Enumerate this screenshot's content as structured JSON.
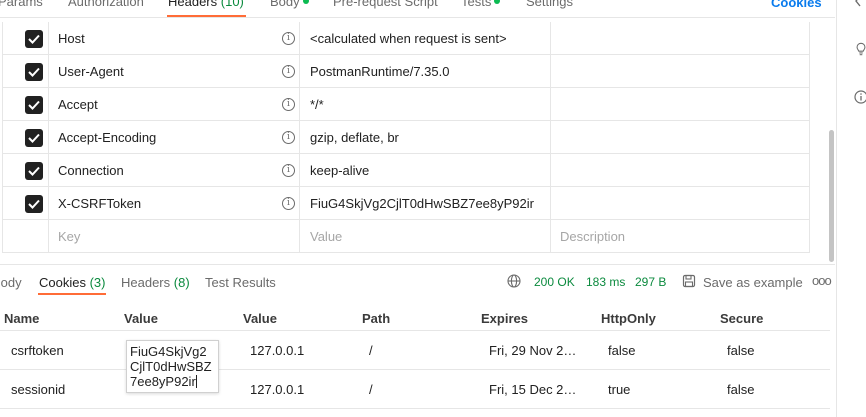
{
  "request_tabs": {
    "params": "Params",
    "authorization": "Authorization",
    "headers": "Headers",
    "headers_count": "(10)",
    "body": "Body",
    "prerequest": "Pre-request Script",
    "tests": "Tests",
    "settings": "Settings",
    "cookies_link": "Cookies"
  },
  "headers_table": {
    "rows": [
      {
        "key": "Host",
        "value": "<calculated when request is sent>",
        "checked": true
      },
      {
        "key": "User-Agent",
        "value": "PostmanRuntime/7.35.0",
        "checked": true
      },
      {
        "key": "Accept",
        "value": "*/*",
        "checked": true
      },
      {
        "key": "Accept-Encoding",
        "value": "gzip, deflate, br",
        "checked": true
      },
      {
        "key": "Connection",
        "value": "keep-alive",
        "checked": true
      },
      {
        "key": "X-CSRFToken",
        "value": "FiuG4SkjVg2CjlT0dHwSBZ7ee8yP92ir",
        "checked": true
      }
    ],
    "placeholder_key": "Key",
    "placeholder_value": "Value",
    "placeholder_description": "Description",
    "info_glyph": "i"
  },
  "response_tabs": {
    "body": "Body",
    "cookies": "Cookies",
    "cookies_count": "(3)",
    "headers": "Headers",
    "headers_count": "(8)",
    "test_results": "Test Results"
  },
  "response_meta": {
    "status": "200 OK",
    "time": "183 ms",
    "size": "297 B",
    "save_example": "Save as example",
    "more": "ooo"
  },
  "cookies_table": {
    "columns": [
      "Name",
      "Value",
      "Value",
      "Path",
      "Expires",
      "HttpOnly",
      "Secure"
    ],
    "rows": [
      {
        "name": "csrftoken",
        "domain": "127.0.0.1",
        "path": "/",
        "expires": "Fri, 29 Nov 2…",
        "httponly": "false",
        "secure": "false"
      },
      {
        "name": "sessionid",
        "domain": "127.0.0.1",
        "path": "/",
        "expires": "Fri, 15 Dec 2…",
        "httponly": "true",
        "secure": "false"
      }
    ],
    "popup_value": "FiuG4SkjVg2CjlT0dHwSBZ7ee8yP92ir"
  },
  "colors": {
    "accent": "#ff6c37",
    "success": "#0b8a3e",
    "link": "#097bed"
  }
}
